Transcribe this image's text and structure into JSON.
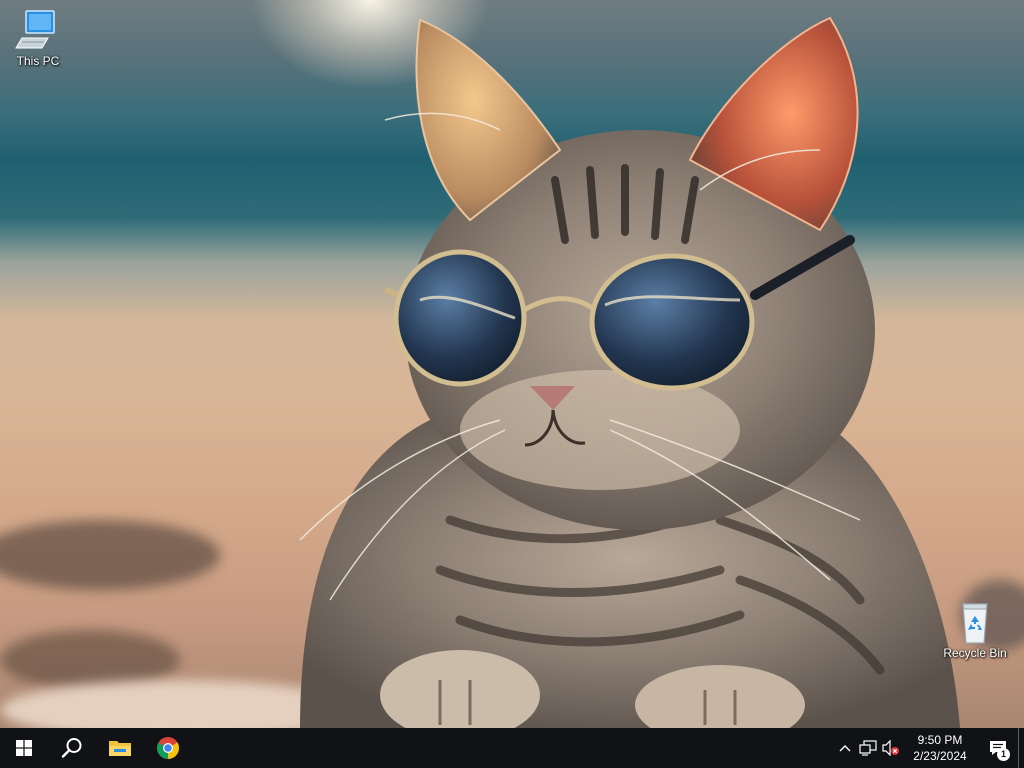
{
  "desktop": {
    "icons": [
      {
        "label": "This PC",
        "icon": "computer-icon"
      },
      {
        "label": "Recycle Bin",
        "icon": "recycle-bin-icon"
      }
    ],
    "wallpaper": "cat-with-sunglasses-on-beach"
  },
  "taskbar": {
    "apps": [
      {
        "name": "start",
        "icon": "windows-logo-icon"
      },
      {
        "name": "search",
        "icon": "search-icon"
      },
      {
        "name": "file-explorer",
        "icon": "folder-icon"
      },
      {
        "name": "chrome",
        "icon": "chrome-icon"
      }
    ],
    "tray": {
      "icons": [
        "chevron-up-icon",
        "network-icon",
        "volume-muted-icon"
      ],
      "time": "9:50 PM",
      "date": "2/23/2024",
      "notification_count": "1"
    }
  },
  "colors": {
    "taskbar_bg": "#101216",
    "folder_yellow": "#f2c13a",
    "accent_blue": "#2a8fe0"
  }
}
